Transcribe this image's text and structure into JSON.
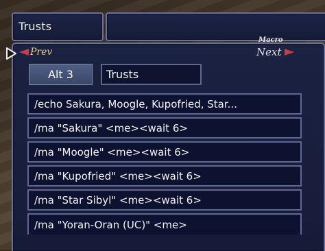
{
  "title": "Trusts",
  "nav": {
    "prev_label": "Prev",
    "next_label": "Next",
    "macro_label": "Macro"
  },
  "macro_set": {
    "tab_label": "Alt 3",
    "name": "Trusts"
  },
  "lines": [
    "/echo Sakura, Moogle, Kupofried, Star...",
    "/ma \"Sakura\" <me><wait 6>",
    "/ma \"Moogle\" <me><wait 6>",
    "/ma \"Kupofried\" <me><wait 6>",
    "/ma \"Star Sibyl\" <me><wait 6>",
    "/ma \"Yoran-Oran (UC)\" <me>"
  ],
  "icons": {
    "pointer": "cursor-hand-icon",
    "prev": "left-arrow-icon",
    "next": "right-arrow-icon"
  },
  "colors": {
    "panel_bg": "#1b2242",
    "border": "#6a7099",
    "arrow_red": "#c0404a",
    "prev_gold": "#e7c98a",
    "tab_active": "#4e5e84"
  }
}
